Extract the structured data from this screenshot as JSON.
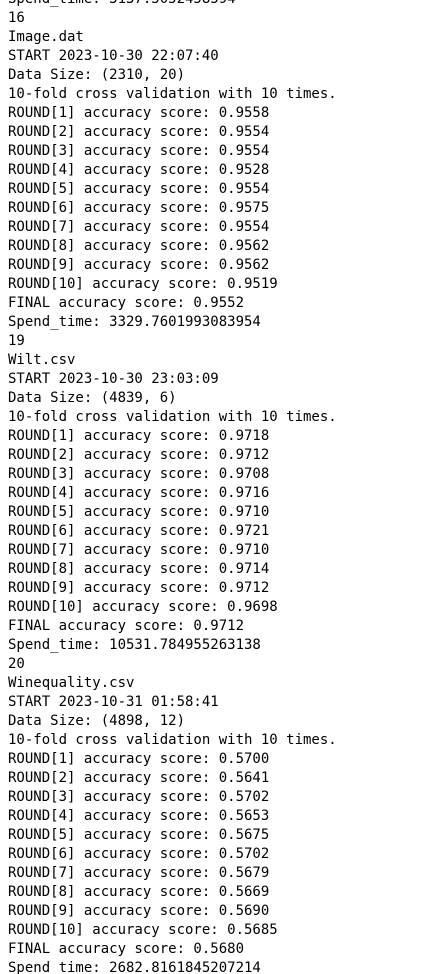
{
  "console": {
    "lines": [
      "Spend_time: 3137.5052458594",
      "16",
      "Image.dat",
      "START 2023-10-30 22:07:40",
      "Data Size: (2310, 20)",
      "10-fold cross validation with 10 times.",
      "ROUND[1] accuracy score: 0.9558",
      "ROUND[2] accuracy score: 0.9554",
      "ROUND[3] accuracy score: 0.9554",
      "ROUND[4] accuracy score: 0.9528",
      "ROUND[5] accuracy score: 0.9554",
      "ROUND[6] accuracy score: 0.9575",
      "ROUND[7] accuracy score: 0.9554",
      "ROUND[8] accuracy score: 0.9562",
      "ROUND[9] accuracy score: 0.9562",
      "ROUND[10] accuracy score: 0.9519",
      "FINAL accuracy score: 0.9552",
      "Spend_time: 3329.7601993083954",
      "19",
      "Wilt.csv",
      "START 2023-10-30 23:03:09",
      "Data Size: (4839, 6)",
      "10-fold cross validation with 10 times.",
      "ROUND[1] accuracy score: 0.9718",
      "ROUND[2] accuracy score: 0.9712",
      "ROUND[3] accuracy score: 0.9708",
      "ROUND[4] accuracy score: 0.9716",
      "ROUND[5] accuracy score: 0.9710",
      "ROUND[6] accuracy score: 0.9721",
      "ROUND[7] accuracy score: 0.9710",
      "ROUND[8] accuracy score: 0.9714",
      "ROUND[9] accuracy score: 0.9712",
      "ROUND[10] accuracy score: 0.9698",
      "FINAL accuracy score: 0.9712",
      "Spend_time: 10531.784955263138",
      "20",
      "Winequality.csv",
      "START 2023-10-31 01:58:41",
      "Data Size: (4898, 12)",
      "10-fold cross validation with 10 times.",
      "ROUND[1] accuracy score: 0.5700",
      "ROUND[2] accuracy score: 0.5641",
      "ROUND[3] accuracy score: 0.5702",
      "ROUND[4] accuracy score: 0.5653",
      "ROUND[5] accuracy score: 0.5675",
      "ROUND[6] accuracy score: 0.5702",
      "ROUND[7] accuracy score: 0.5679",
      "ROUND[8] accuracy score: 0.5669",
      "ROUND[9] accuracy score: 0.5690",
      "ROUND[10] accuracy score: 0.5685",
      "FINAL accuracy score: 0.5680",
      "Spend_time: 2682.8161845207214"
    ]
  }
}
